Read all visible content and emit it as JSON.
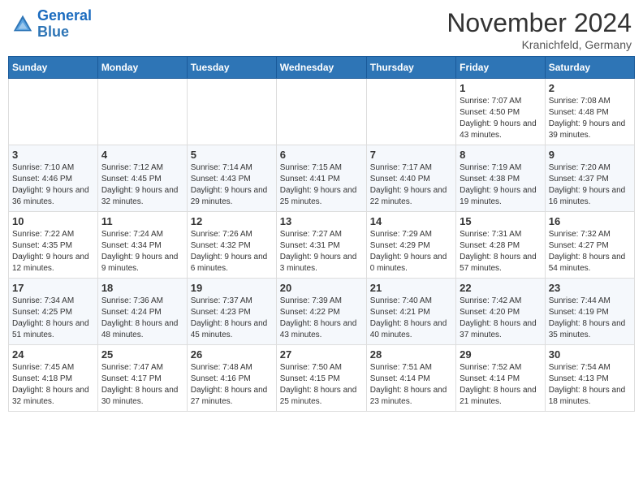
{
  "logo": {
    "line1": "General",
    "line2": "Blue"
  },
  "title": "November 2024",
  "location": "Kranichfeld, Germany",
  "weekdays": [
    "Sunday",
    "Monday",
    "Tuesday",
    "Wednesday",
    "Thursday",
    "Friday",
    "Saturday"
  ],
  "weeks": [
    [
      {
        "day": "",
        "info": ""
      },
      {
        "day": "",
        "info": ""
      },
      {
        "day": "",
        "info": ""
      },
      {
        "day": "",
        "info": ""
      },
      {
        "day": "",
        "info": ""
      },
      {
        "day": "1",
        "info": "Sunrise: 7:07 AM\nSunset: 4:50 PM\nDaylight: 9 hours and 43 minutes."
      },
      {
        "day": "2",
        "info": "Sunrise: 7:08 AM\nSunset: 4:48 PM\nDaylight: 9 hours and 39 minutes."
      }
    ],
    [
      {
        "day": "3",
        "info": "Sunrise: 7:10 AM\nSunset: 4:46 PM\nDaylight: 9 hours and 36 minutes."
      },
      {
        "day": "4",
        "info": "Sunrise: 7:12 AM\nSunset: 4:45 PM\nDaylight: 9 hours and 32 minutes."
      },
      {
        "day": "5",
        "info": "Sunrise: 7:14 AM\nSunset: 4:43 PM\nDaylight: 9 hours and 29 minutes."
      },
      {
        "day": "6",
        "info": "Sunrise: 7:15 AM\nSunset: 4:41 PM\nDaylight: 9 hours and 25 minutes."
      },
      {
        "day": "7",
        "info": "Sunrise: 7:17 AM\nSunset: 4:40 PM\nDaylight: 9 hours and 22 minutes."
      },
      {
        "day": "8",
        "info": "Sunrise: 7:19 AM\nSunset: 4:38 PM\nDaylight: 9 hours and 19 minutes."
      },
      {
        "day": "9",
        "info": "Sunrise: 7:20 AM\nSunset: 4:37 PM\nDaylight: 9 hours and 16 minutes."
      }
    ],
    [
      {
        "day": "10",
        "info": "Sunrise: 7:22 AM\nSunset: 4:35 PM\nDaylight: 9 hours and 12 minutes."
      },
      {
        "day": "11",
        "info": "Sunrise: 7:24 AM\nSunset: 4:34 PM\nDaylight: 9 hours and 9 minutes."
      },
      {
        "day": "12",
        "info": "Sunrise: 7:26 AM\nSunset: 4:32 PM\nDaylight: 9 hours and 6 minutes."
      },
      {
        "day": "13",
        "info": "Sunrise: 7:27 AM\nSunset: 4:31 PM\nDaylight: 9 hours and 3 minutes."
      },
      {
        "day": "14",
        "info": "Sunrise: 7:29 AM\nSunset: 4:29 PM\nDaylight: 9 hours and 0 minutes."
      },
      {
        "day": "15",
        "info": "Sunrise: 7:31 AM\nSunset: 4:28 PM\nDaylight: 8 hours and 57 minutes."
      },
      {
        "day": "16",
        "info": "Sunrise: 7:32 AM\nSunset: 4:27 PM\nDaylight: 8 hours and 54 minutes."
      }
    ],
    [
      {
        "day": "17",
        "info": "Sunrise: 7:34 AM\nSunset: 4:25 PM\nDaylight: 8 hours and 51 minutes."
      },
      {
        "day": "18",
        "info": "Sunrise: 7:36 AM\nSunset: 4:24 PM\nDaylight: 8 hours and 48 minutes."
      },
      {
        "day": "19",
        "info": "Sunrise: 7:37 AM\nSunset: 4:23 PM\nDaylight: 8 hours and 45 minutes."
      },
      {
        "day": "20",
        "info": "Sunrise: 7:39 AM\nSunset: 4:22 PM\nDaylight: 8 hours and 43 minutes."
      },
      {
        "day": "21",
        "info": "Sunrise: 7:40 AM\nSunset: 4:21 PM\nDaylight: 8 hours and 40 minutes."
      },
      {
        "day": "22",
        "info": "Sunrise: 7:42 AM\nSunset: 4:20 PM\nDaylight: 8 hours and 37 minutes."
      },
      {
        "day": "23",
        "info": "Sunrise: 7:44 AM\nSunset: 4:19 PM\nDaylight: 8 hours and 35 minutes."
      }
    ],
    [
      {
        "day": "24",
        "info": "Sunrise: 7:45 AM\nSunset: 4:18 PM\nDaylight: 8 hours and 32 minutes."
      },
      {
        "day": "25",
        "info": "Sunrise: 7:47 AM\nSunset: 4:17 PM\nDaylight: 8 hours and 30 minutes."
      },
      {
        "day": "26",
        "info": "Sunrise: 7:48 AM\nSunset: 4:16 PM\nDaylight: 8 hours and 27 minutes."
      },
      {
        "day": "27",
        "info": "Sunrise: 7:50 AM\nSunset: 4:15 PM\nDaylight: 8 hours and 25 minutes."
      },
      {
        "day": "28",
        "info": "Sunrise: 7:51 AM\nSunset: 4:14 PM\nDaylight: 8 hours and 23 minutes."
      },
      {
        "day": "29",
        "info": "Sunrise: 7:52 AM\nSunset: 4:14 PM\nDaylight: 8 hours and 21 minutes."
      },
      {
        "day": "30",
        "info": "Sunrise: 7:54 AM\nSunset: 4:13 PM\nDaylight: 8 hours and 18 minutes."
      }
    ]
  ]
}
